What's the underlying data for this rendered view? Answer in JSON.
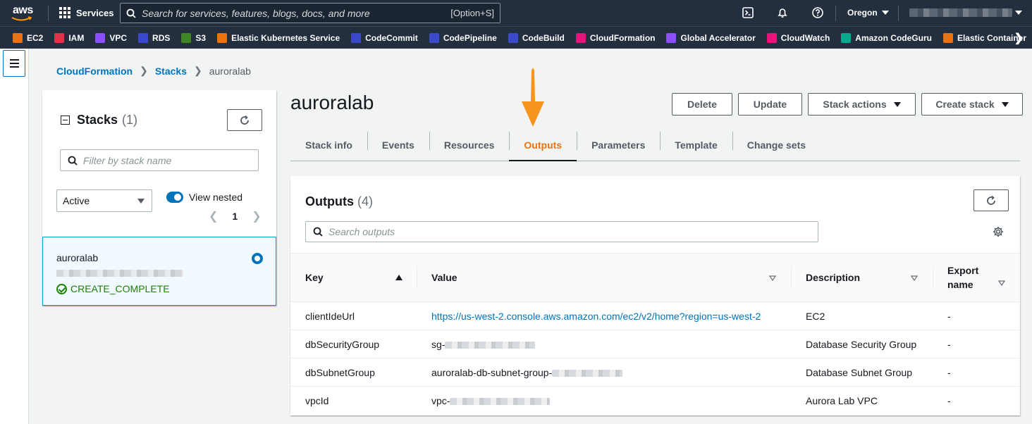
{
  "topnav": {
    "logo_text": "aws",
    "services_label": "Services",
    "search_placeholder": "Search for services, features, blogs, docs, and more",
    "search_shortcut": "[Option+S]",
    "region": "Oregon"
  },
  "favorites": [
    {
      "label": "EC2",
      "color": "#ec7211"
    },
    {
      "label": "IAM",
      "color": "#dd344c"
    },
    {
      "label": "VPC",
      "color": "#8c4fff"
    },
    {
      "label": "RDS",
      "color": "#3b48cc"
    },
    {
      "label": "S3",
      "color": "#3f8624"
    },
    {
      "label": "Elastic Kubernetes Service",
      "color": "#ec7211"
    },
    {
      "label": "CodeCommit",
      "color": "#3b48cc"
    },
    {
      "label": "CodePipeline",
      "color": "#3b48cc"
    },
    {
      "label": "CodeBuild",
      "color": "#3b48cc"
    },
    {
      "label": "CloudFormation",
      "color": "#e7157b"
    },
    {
      "label": "Global Accelerator",
      "color": "#8c4fff"
    },
    {
      "label": "CloudWatch",
      "color": "#e7157b"
    },
    {
      "label": "Amazon CodeGuru",
      "color": "#01a88d"
    },
    {
      "label": "Elastic Container",
      "color": "#ec7211"
    }
  ],
  "breadcrumb": {
    "items": [
      "CloudFormation",
      "Stacks"
    ],
    "current": "auroralab"
  },
  "stacks_panel": {
    "title": "Stacks",
    "count": "(1)",
    "filter_placeholder": "Filter by stack name",
    "status_filter": "Active",
    "view_nested_label": "View nested",
    "page": "1",
    "stack": {
      "name": "auroralab",
      "status": "CREATE_COMPLETE"
    }
  },
  "main": {
    "stack_name": "auroralab",
    "buttons": {
      "delete": "Delete",
      "update": "Update",
      "stack_actions": "Stack actions",
      "create_stack": "Create stack"
    },
    "tabs": [
      "Stack info",
      "Events",
      "Resources",
      "Outputs",
      "Parameters",
      "Template",
      "Change sets"
    ],
    "active_tab": "Outputs"
  },
  "outputs": {
    "title": "Outputs",
    "count": "(4)",
    "search_placeholder": "Search outputs",
    "columns": {
      "key": "Key",
      "value": "Value",
      "description": "Description",
      "export_line1": "Export",
      "export_line2": "name"
    },
    "rows": [
      {
        "key": "clientIdeUrl",
        "value": "https://us-west-2.console.aws.amazon.com/ec2/v2/home?region=us-west-2",
        "description": "EC2",
        "export": "-"
      },
      {
        "key": "dbSecurityGroup",
        "value": "sg-",
        "description": "Database Security Group",
        "export": "-"
      },
      {
        "key": "dbSubnetGroup",
        "value": "auroralab-db-subnet-group-",
        "description": "Database Subnet Group",
        "export": "-"
      },
      {
        "key": "vpcId",
        "value": "vpc-",
        "description": "Aurora Lab VPC",
        "export": "-"
      }
    ]
  },
  "colors": {
    "nav_bg": "#232f3e",
    "link": "#0073bb",
    "accent_orange": "#ec7211",
    "success": "#1d8102"
  }
}
